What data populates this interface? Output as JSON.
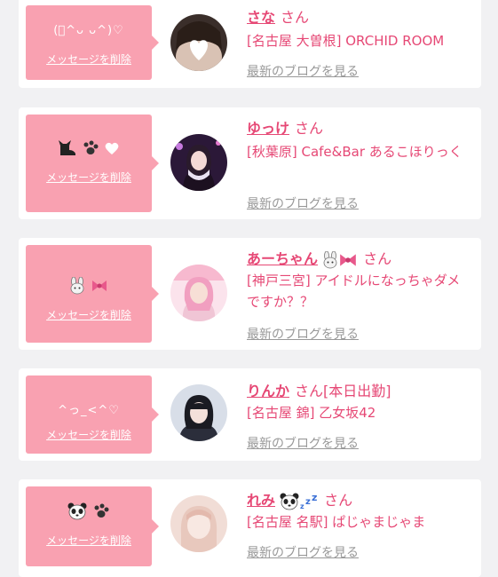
{
  "colors": {
    "accent": "#e64875",
    "message_bg": "#f9a1b1",
    "link_gray": "#999999",
    "page_bg": "#f1f1f3"
  },
  "delete_label": "メッセージを削除",
  "blog_label": "最新のブログを見る",
  "san_label": "さん",
  "entries": [
    {
      "message": "(ﾟ^ᴗ ᴗ^)♡",
      "name": "さな",
      "status": "",
      "shop": "[名古屋 大曽根] ORCHID ROOM",
      "name_icons": []
    },
    {
      "message": "",
      "name": "ゆっけ",
      "status": "",
      "shop": "[秋葉原] Cafe&Bar あるこほりっく",
      "name_icons": [],
      "message_icons": [
        "cat-icon",
        "paw-icon",
        "heart-icon"
      ]
    },
    {
      "message": "",
      "name": "あーちゃん",
      "status": "",
      "shop": "[神戸三宮] アイドルになっちゃダメですか？？",
      "name_icons": [
        "bunny-icon",
        "ribbon-icon"
      ],
      "message_icons": [
        "bunny-icon",
        "ribbon-icon"
      ]
    },
    {
      "message": "^っ_<^♡",
      "name": "りんか",
      "status": "[本日出勤]",
      "shop": "[名古屋 錦] 乙女坂42",
      "name_icons": []
    },
    {
      "message": "",
      "name": "れみ",
      "status": "",
      "shop": "[名古屋 名駅] ぱじゃまじゃま",
      "name_icons": [
        "panda-icon",
        "zzz-icon"
      ],
      "message_icons": [
        "panda-icon",
        "paw-icon"
      ]
    }
  ]
}
